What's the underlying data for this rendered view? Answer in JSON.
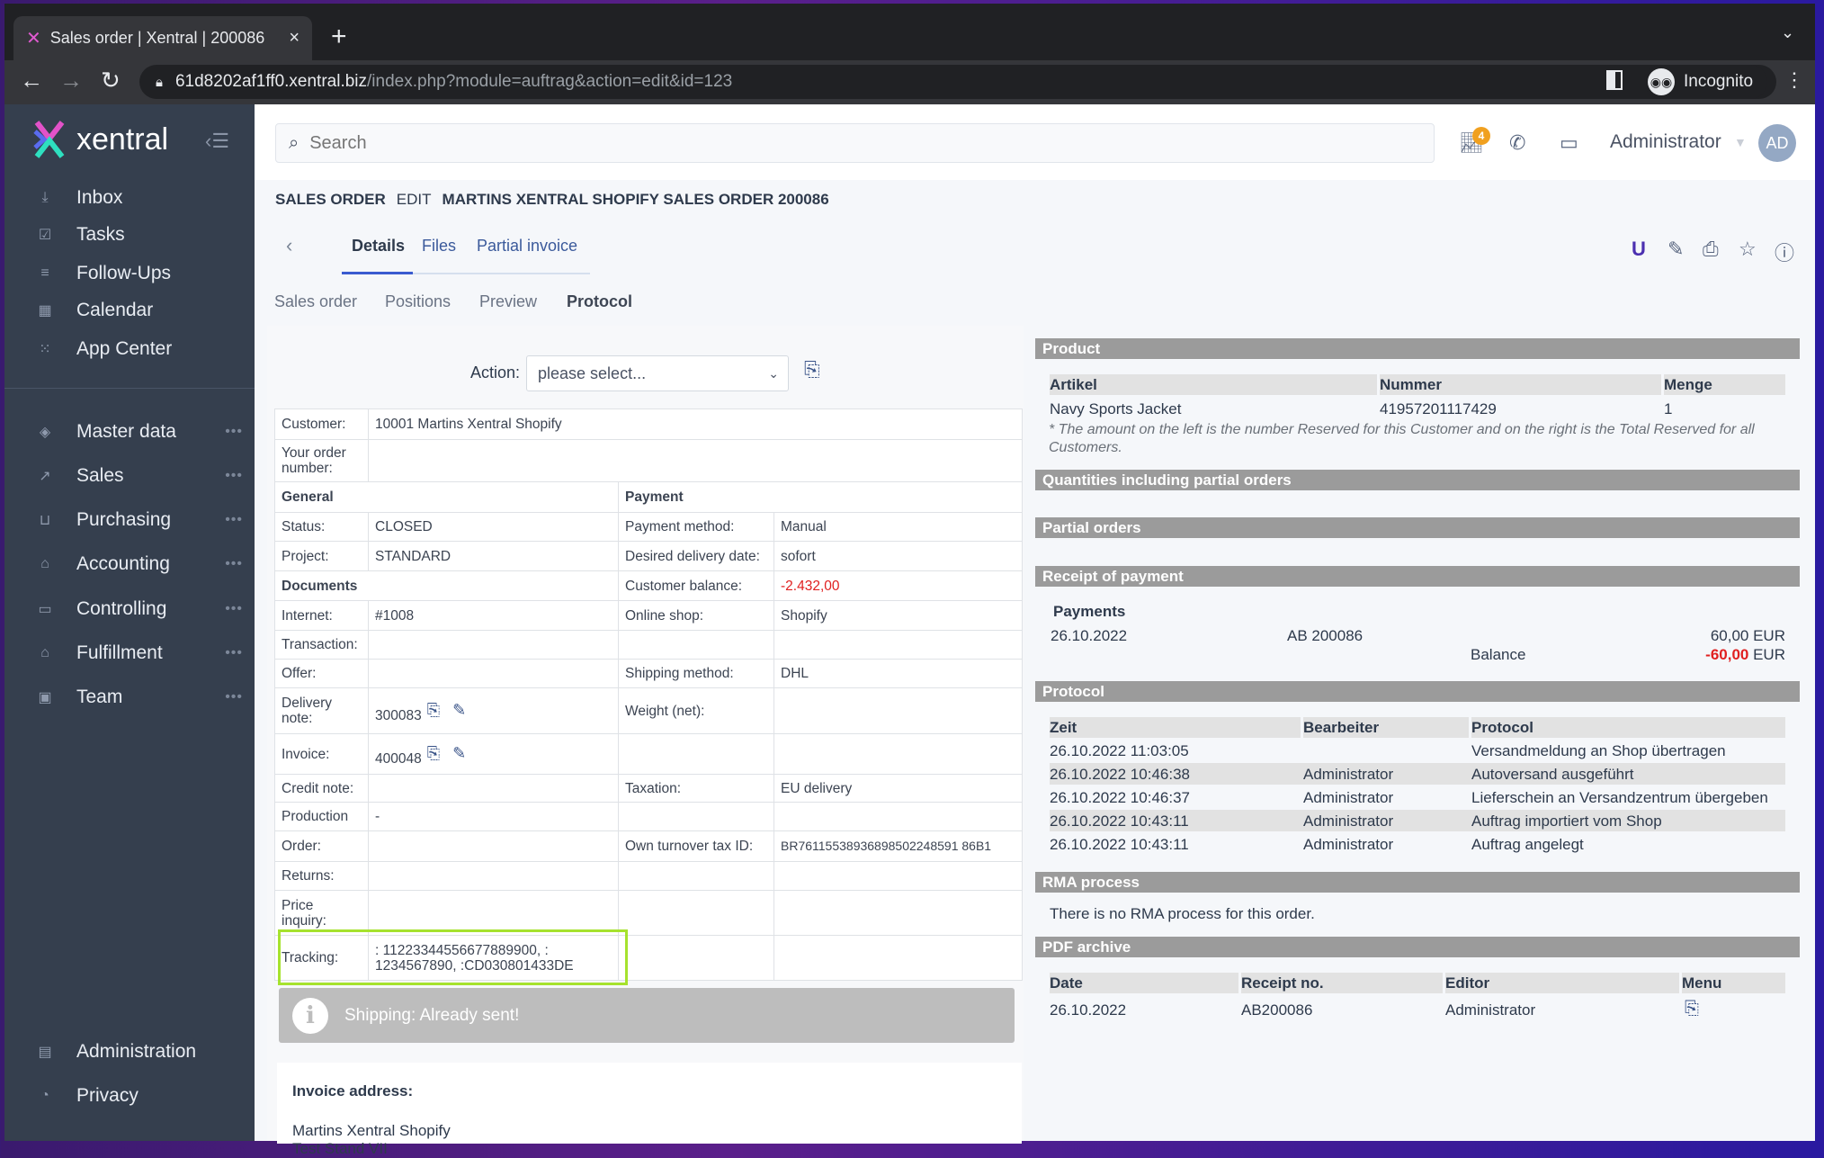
{
  "browser": {
    "tab_title": "Sales order | Xentral | 200086",
    "url_host": "61d8202af1ff0.xentral.biz",
    "url_path": "/index.php?module=auftrag&action=edit&id=123",
    "incognito_label": "Incognito"
  },
  "sidebar": {
    "brand": "xentral",
    "top_items": [
      {
        "label": "Inbox",
        "icon": "inbox-icon"
      },
      {
        "label": "Tasks",
        "icon": "tasks-icon"
      },
      {
        "label": "Follow-Ups",
        "icon": "follow-ups-icon"
      },
      {
        "label": "Calendar",
        "icon": "calendar-icon"
      },
      {
        "label": "App Center",
        "icon": "grid-icon"
      }
    ],
    "modules": [
      {
        "label": "Master data",
        "icon": "layers-icon"
      },
      {
        "label": "Sales",
        "icon": "trend-icon"
      },
      {
        "label": "Purchasing",
        "icon": "basket-icon"
      },
      {
        "label": "Accounting",
        "icon": "bank-icon"
      },
      {
        "label": "Controlling",
        "icon": "monitor-icon"
      },
      {
        "label": "Fulfillment",
        "icon": "warehouse-icon"
      },
      {
        "label": "Team",
        "icon": "team-icon"
      }
    ],
    "bottom_items": [
      {
        "label": "Administration",
        "icon": "settings-icon"
      },
      {
        "label": "Privacy",
        "icon": "privacy-icon"
      }
    ]
  },
  "header": {
    "search_placeholder": "Search",
    "notification_count": "4",
    "user_name": "Administrator",
    "avatar_initials": "AD"
  },
  "breadcrumb": {
    "module": "SALES ORDER",
    "action": "EDIT",
    "title": "MARTINS XENTRAL SHOPIFY SALES ORDER 200086"
  },
  "tabs": [
    "Details",
    "Files",
    "Partial invoice"
  ],
  "subtabs": [
    "Sales order",
    "Positions",
    "Preview",
    "Protocol"
  ],
  "action": {
    "label": "Action:",
    "selected": "please select..."
  },
  "details_rows": [
    {
      "l": "Customer:",
      "v": "10001 Martins Xentral Shopify",
      "full": true
    },
    {
      "l": "Your order number:",
      "v": "",
      "full": true
    },
    {
      "h1": "General",
      "h2": "Payment"
    },
    {
      "l": "Status:",
      "v": "CLOSED",
      "l2": "Payment method:",
      "v2": "Manual"
    },
    {
      "l": "Project:",
      "v": "STANDARD",
      "l2": "Desired delivery date:",
      "v2": "sofort"
    },
    {
      "h1": "Documents",
      "l2": "Customer balance:",
      "v2": "-2.432,00",
      "red": true
    },
    {
      "l": "Internet:",
      "v": "#1008",
      "l2": "Online shop:",
      "v2": "Shopify"
    },
    {
      "l": "Transaction:",
      "v": "",
      "l2": "",
      "v2": ""
    },
    {
      "l": "Offer:",
      "v": "",
      "l2": "Shipping method:",
      "v2": "DHL"
    },
    {
      "l": "Delivery note:",
      "v": "300083",
      "icons": true,
      "l2": "Weight (net):",
      "v2": ""
    },
    {
      "l": "Invoice:",
      "v": "400048",
      "icons": true,
      "l2": "",
      "v2": ""
    },
    {
      "l": "Credit note:",
      "v": "",
      "l2": "Taxation:",
      "v2": "EU delivery"
    },
    {
      "l": "Production",
      "v": "-",
      "l2": "",
      "v2": ""
    },
    {
      "l": "Order:",
      "v": "",
      "l2": "Own turnover tax ID:",
      "v2": "BR76115538936898502248591 86B1"
    },
    {
      "l": "Returns:",
      "v": "",
      "l2": "",
      "v2": ""
    },
    {
      "l": "Price inquiry:",
      "v": "",
      "l2": "",
      "v2": ""
    },
    {
      "l": "Tracking:",
      "v": ": 11223344556677889900, : 1234567890, :CD030801433DE",
      "l2": "",
      "v2": ""
    }
  ],
  "shipping_info": "Shipping: Already sent!",
  "invoice_address": {
    "title": "Invoice address:",
    "line1": "Martins Xentral Shopify",
    "line2": "Test Stand VII"
  },
  "right": {
    "product": {
      "title": "Product",
      "headers": [
        "Artikel",
        "Nummer",
        "Menge"
      ],
      "row": [
        "Navy Sports Jacket",
        "41957201117429",
        "1"
      ],
      "note": "* The amount on the left is the number Reserved for this Customer and on the right is the Total Reserved for all Customers."
    },
    "quantities_title": "Quantities including partial orders",
    "partial_orders_title": "Partial orders",
    "receipt": {
      "title": "Receipt of payment",
      "payments_label": "Payments",
      "date": "26.10.2022",
      "ref": "AB 200086",
      "amount": "60,00 EUR",
      "balance_label": "Balance",
      "balance_value": "-60,00",
      "balance_currency": " EUR"
    },
    "protocol": {
      "title": "Protocol",
      "headers": [
        "Zeit",
        "Bearbeiter",
        "Protocol"
      ],
      "rows": [
        [
          "26.10.2022 11:03:05",
          "",
          "Versandmeldung an Shop übertragen"
        ],
        [
          "26.10.2022 10:46:38",
          "Administrator",
          "Autoversand ausgeführt"
        ],
        [
          "26.10.2022 10:46:37",
          "Administrator",
          "Lieferschein an Versandzentrum übergeben"
        ],
        [
          "26.10.2022 10:43:11",
          "Administrator",
          "Auftrag importiert vom Shop"
        ],
        [
          "26.10.2022 10:43:11",
          "Administrator",
          "Auftrag angelegt"
        ]
      ]
    },
    "rma": {
      "title": "RMA process",
      "text": "There is no RMA process for this order."
    },
    "pdf": {
      "title": "PDF archive",
      "headers": [
        "Date",
        "Receipt no.",
        "Editor",
        "Menu"
      ],
      "row": [
        "26.10.2022",
        "AB200086",
        "Administrator"
      ]
    }
  }
}
